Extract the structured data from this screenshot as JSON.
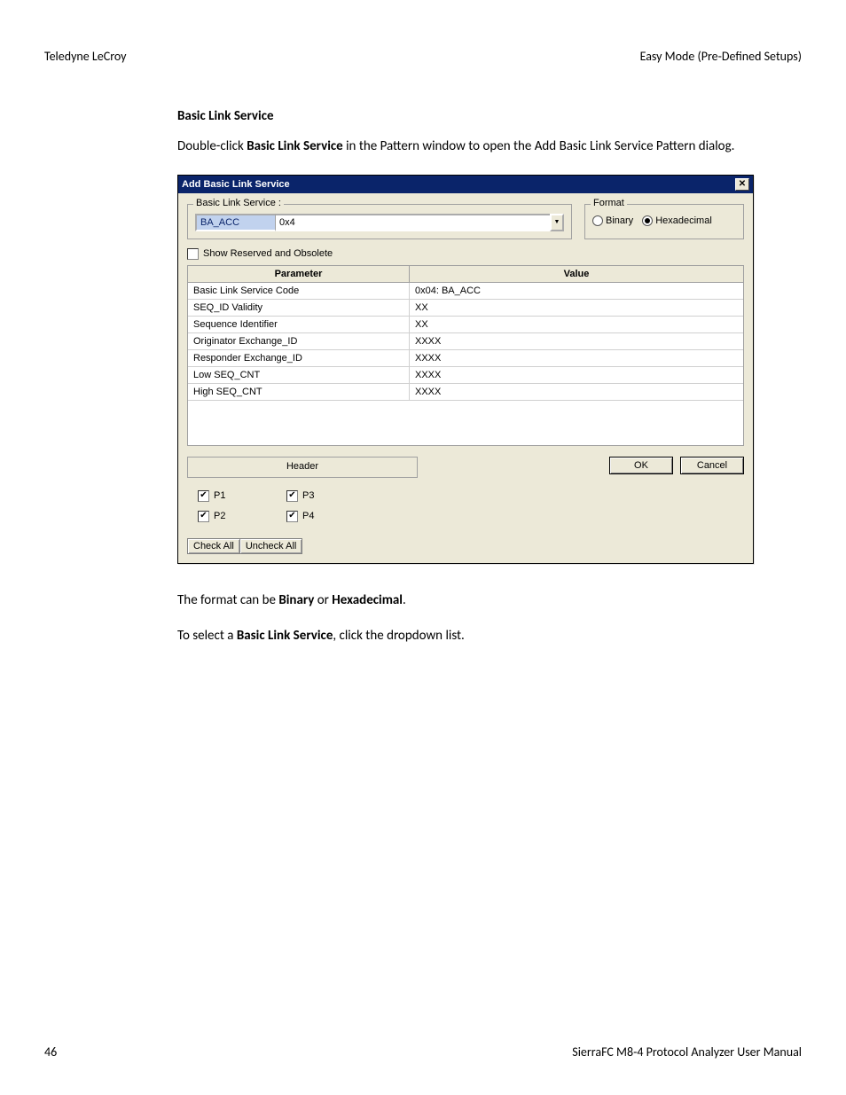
{
  "header": {
    "left": "Teledyne LeCroy",
    "right": "Easy Mode (Pre-Defined Setups)"
  },
  "section": {
    "heading": "Basic Link Service",
    "intro_pre": "Double-click ",
    "intro_bold": "Basic Link Service",
    "intro_post": " in the Pattern window to open the Add Basic Link Service Pattern dialog."
  },
  "dialog": {
    "title": "Add Basic Link Service",
    "close_glyph": "✕",
    "bls_legend": "Basic Link Service :",
    "dd_name": "BA_ACC",
    "dd_code": "0x4",
    "dd_arrow": "▼",
    "format_legend": "Format",
    "radio_binary": "Binary",
    "radio_hex": "Hexadecimal",
    "chk_reserved": "Show Reserved and Obsolete",
    "col_param": "Parameter",
    "col_value": "Value",
    "rows": [
      {
        "p": "Basic Link Service Code",
        "v": "0x04: BA_ACC"
      },
      {
        "p": "SEQ_ID Validity",
        "v": "XX"
      },
      {
        "p": "Sequence Identifier",
        "v": "XX"
      },
      {
        "p": "Originator Exchange_ID",
        "v": "XXXX"
      },
      {
        "p": "Responder Exchange_ID",
        "v": "XXXX"
      },
      {
        "p": "Low SEQ_CNT",
        "v": "XXXX"
      },
      {
        "p": "High SEQ_CNT",
        "v": "XXXX"
      }
    ],
    "header_box": "Header",
    "ok": "OK",
    "cancel": "Cancel",
    "ports": [
      "P1",
      "P3",
      "P2",
      "P4"
    ],
    "check_mark": "✔",
    "check_all": "Check All",
    "uncheck_all": "Uncheck All"
  },
  "para2": {
    "t1": "The format can be ",
    "b1": "Binary",
    "t2": " or ",
    "b2": "Hexadecimal",
    "t3": "."
  },
  "para3": {
    "t1": "To select a ",
    "b1": "Basic Link Service",
    "t2": ", click the dropdown list."
  },
  "footer": {
    "page": "46",
    "manual": "SierraFC M8-4 Protocol Analyzer User Manual"
  }
}
